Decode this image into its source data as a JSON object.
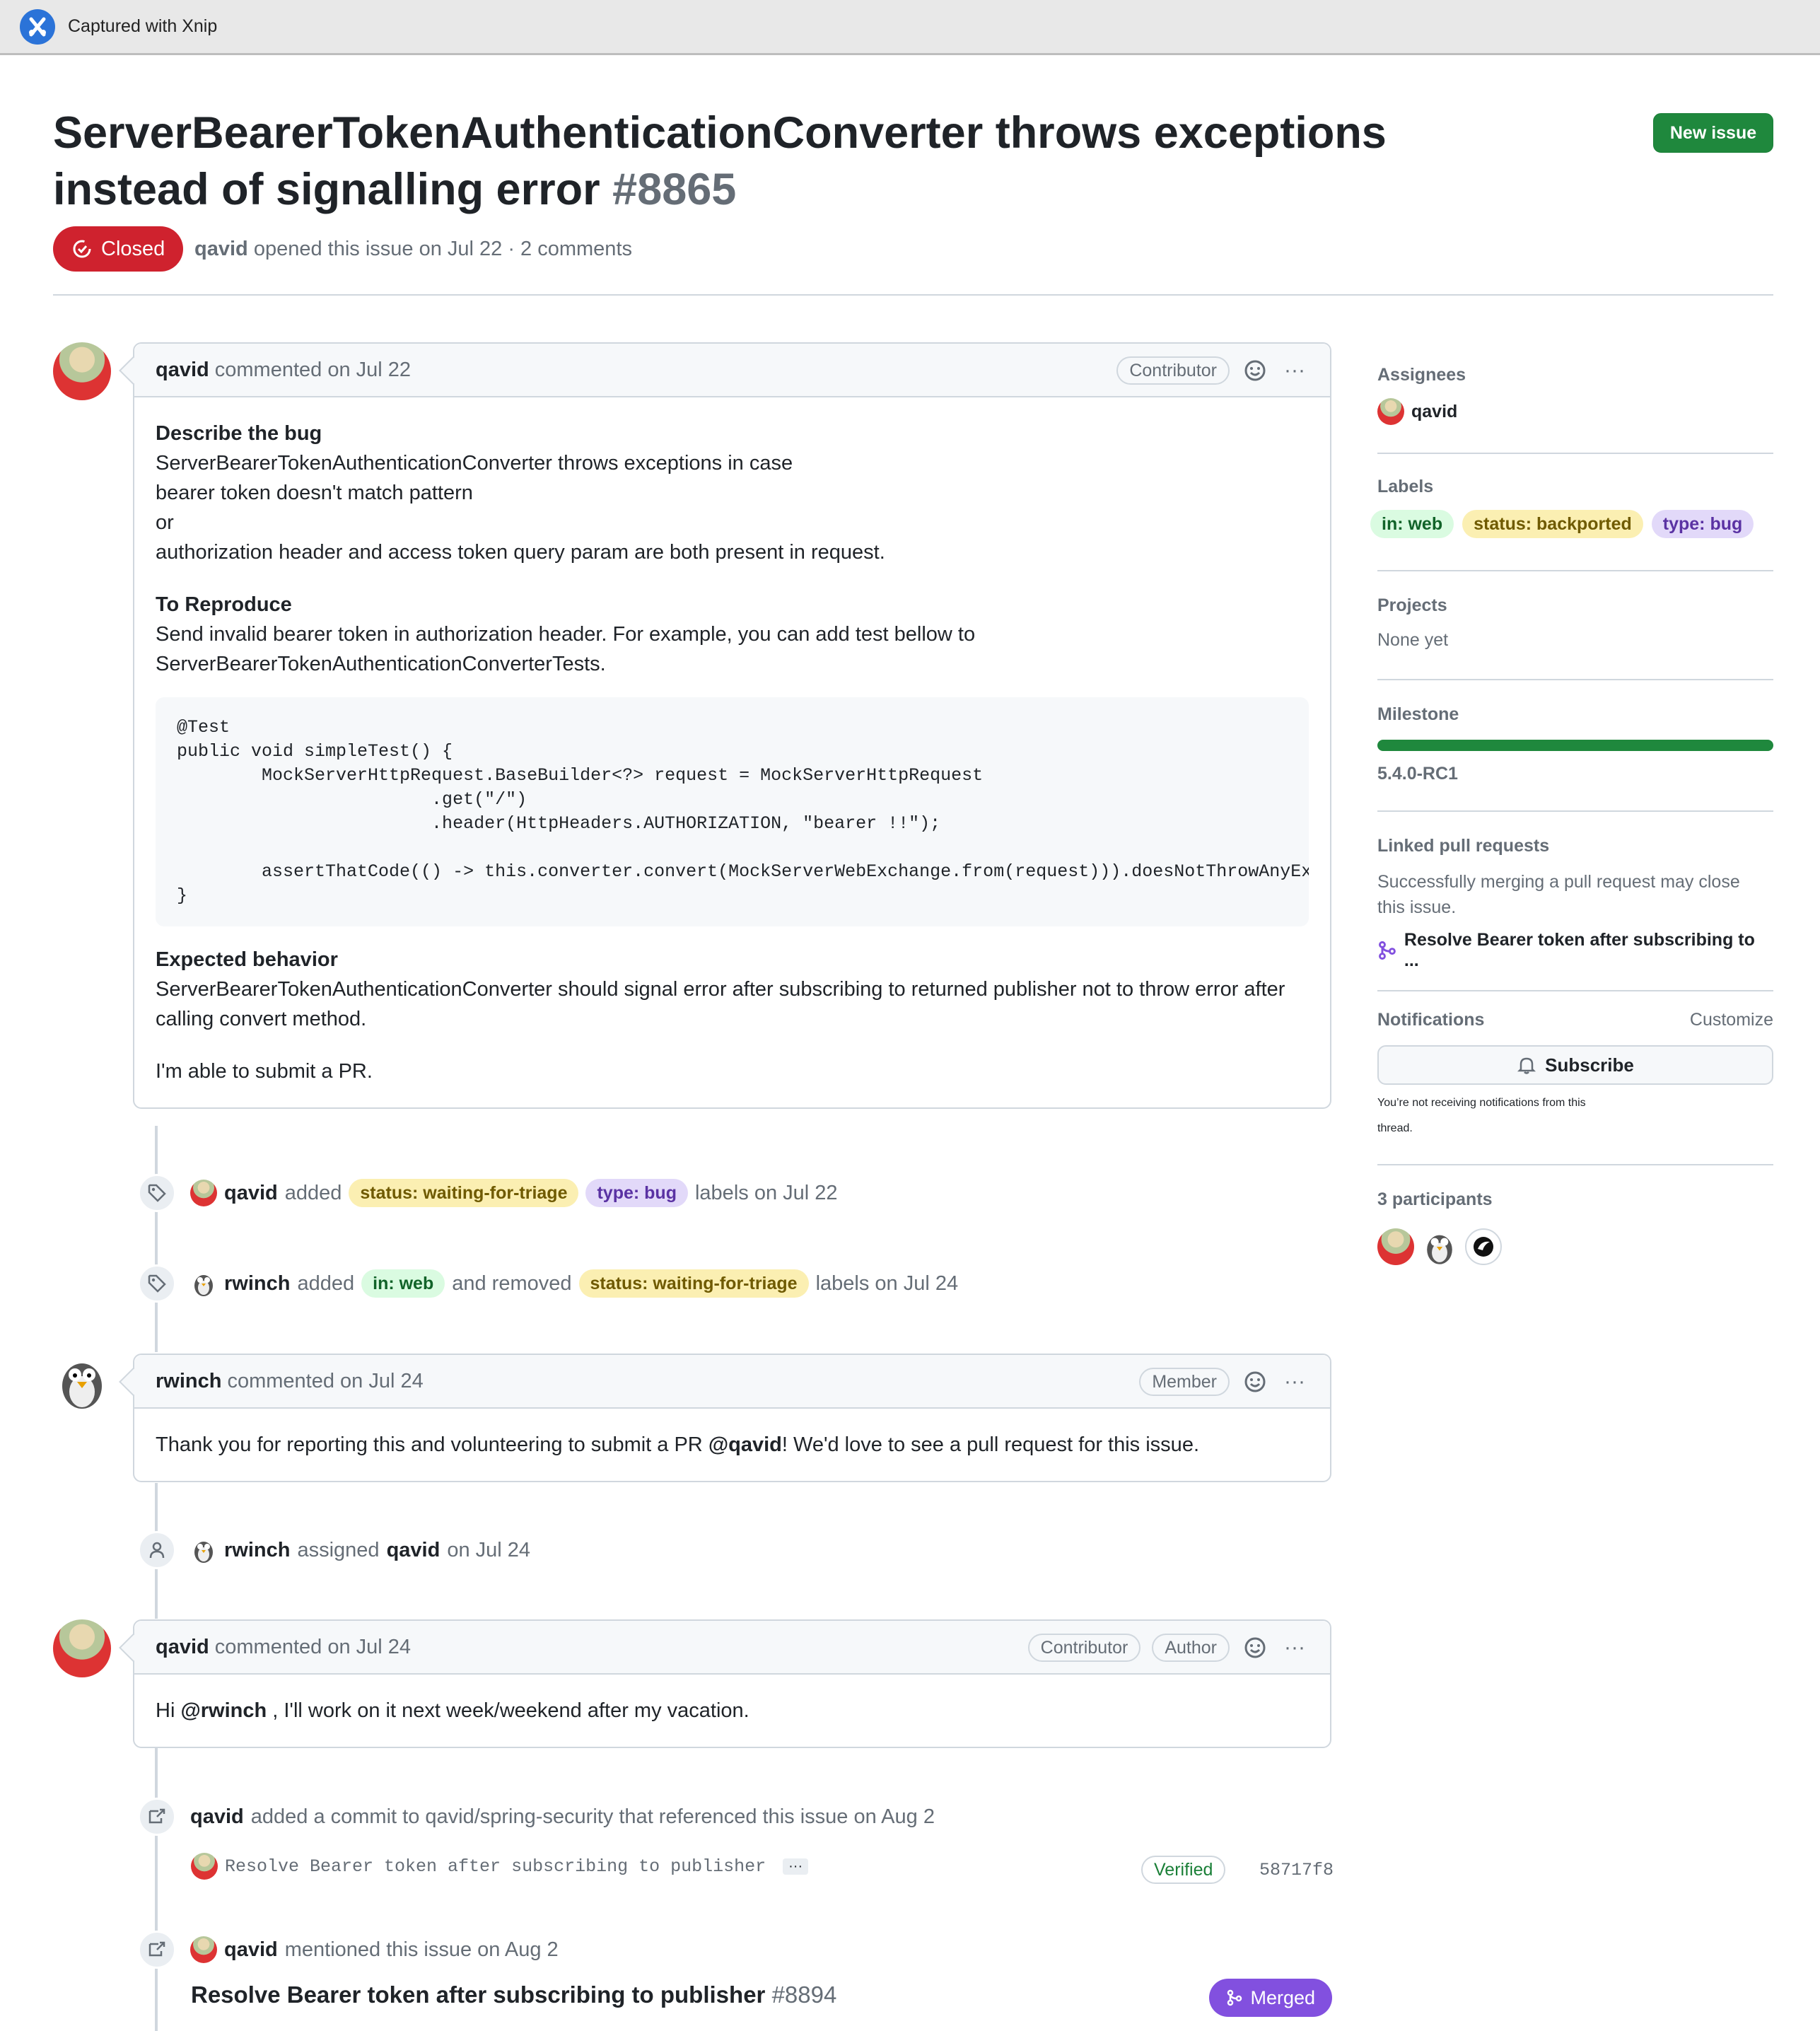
{
  "capture_bar": {
    "text": "Captured with Xnip"
  },
  "issue": {
    "title": "ServerBearerTokenAuthenticationConverter throws exceptions instead of signalling error",
    "number": "#8865",
    "new_issue_label": "New issue",
    "state": "Closed",
    "meta_author": "qavid",
    "meta_text": "opened this issue on Jul 22 · 2 comments"
  },
  "comments": [
    {
      "author": "qavid",
      "when": "commented on Jul 22",
      "badges": [
        "Contributor"
      ],
      "body": {
        "h1": "Describe the bug",
        "p1": [
          "ServerBearerTokenAuthenticationConverter throws exceptions in case",
          "bearer token doesn't match pattern",
          "or",
          "authorization header and access token query param are both present in request."
        ],
        "h2": "To Reproduce",
        "p2": [
          "Send invalid bearer token in authorization header. For example, you can add test bellow to",
          "ServerBearerTokenAuthenticationConverterTests."
        ],
        "code": "@Test\npublic void simpleTest() {\n        MockServerHttpRequest.BaseBuilder<?> request = MockServerHttpRequest\n                        .get(\"/\")\n                        .header(HttpHeaders.AUTHORIZATION, \"bearer !!\");\n\n        assertThatCode(() -> this.converter.convert(MockServerWebExchange.from(request))).doesNotThrowAnyExcepti\n}",
        "h3": "Expected behavior",
        "p3": [
          "ServerBearerTokenAuthenticationConverter should signal error after subscribing to returned publisher not to throw error after",
          "calling convert method."
        ],
        "p4": "I'm able to submit a PR."
      }
    },
    {
      "author": "rwinch",
      "when": "commented on Jul 24",
      "badges": [
        "Member"
      ],
      "body_pre": "Thank you for reporting this and volunteering to submit a PR",
      "mention": "@qavid",
      "body_post": "! We'd love to see a pull request for this issue."
    },
    {
      "author": "qavid",
      "when": "commented on Jul 24",
      "badges": [
        "Contributor",
        "Author"
      ],
      "body_pre": "Hi",
      "mention": "@rwinch",
      "body_post": ", I'll work on it next week/weekend after my vacation."
    }
  ],
  "events": {
    "e1": {
      "actor": "qavid",
      "verb": "added",
      "labels": [
        "status: waiting-for-triage",
        "type: bug"
      ],
      "tail": "labels on Jul 22"
    },
    "e2": {
      "actor": "rwinch",
      "verb": "added",
      "label_added": "in: web",
      "mid": "and removed",
      "label_removed": "status: waiting-for-triage",
      "tail": "labels on Jul 24"
    },
    "e3": {
      "actor": "rwinch",
      "verb": "assigned",
      "target": "qavid",
      "tail": "on Jul 24"
    },
    "e4": {
      "actor": "qavid",
      "text": "added a commit to qavid/spring-security that referenced this issue on Aug 2",
      "commit_msg": "Resolve Bearer token after subscribing to publisher",
      "ellipsis": "···",
      "verified": "Verified",
      "sha": "58717f8"
    },
    "e5": {
      "actor": "qavid",
      "text": "mentioned this issue on Aug 2",
      "pr_title": "Resolve Bearer token after subscribing to publisher",
      "pr_number": "#8894",
      "pr_state": "Merged"
    }
  },
  "sidebar": {
    "assignees": {
      "heading": "Assignees",
      "name": "qavid"
    },
    "labels": {
      "heading": "Labels",
      "items": [
        "in: web",
        "status: backported",
        "type: bug"
      ]
    },
    "projects": {
      "heading": "Projects",
      "value": "None yet"
    },
    "milestone": {
      "heading": "Milestone",
      "name": "5.4.0-RC1",
      "progress": 1.0
    },
    "linked": {
      "heading": "Linked pull requests",
      "desc": [
        "Successfully merging a pull request may close",
        "this issue."
      ],
      "pr": "Resolve Bearer token after subscribing to ..."
    },
    "notifications": {
      "heading": "Notifications",
      "customize": "Customize",
      "subscribe": "Subscribe",
      "desc": [
        "You’re not receiving notifications from this",
        "thread."
      ]
    },
    "participants": {
      "heading": "3 participants"
    }
  },
  "colors": {
    "closed": "#cf222e",
    "merged": "#8250df",
    "green": "#1f883d"
  }
}
